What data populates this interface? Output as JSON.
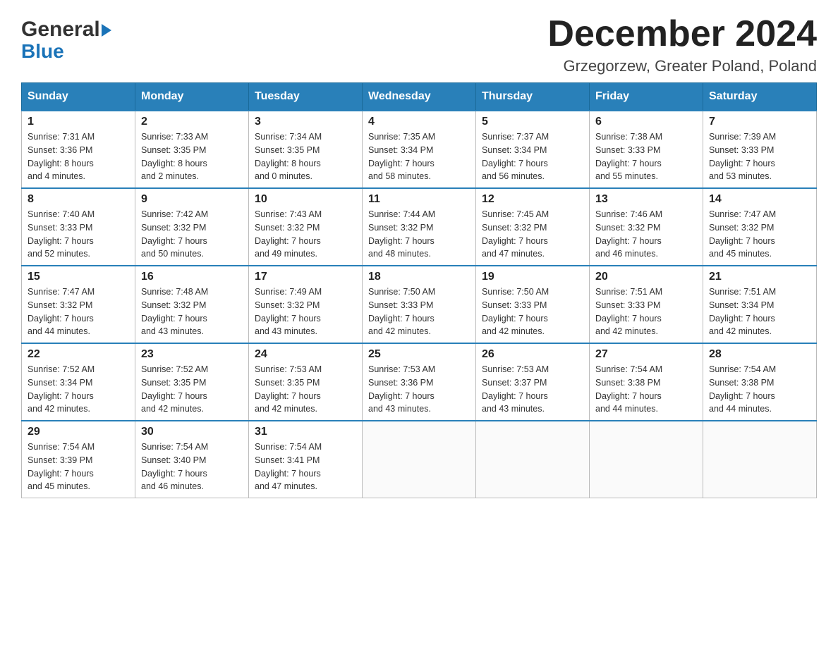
{
  "logo": {
    "general": "General",
    "blue": "Blue"
  },
  "header": {
    "month": "December 2024",
    "location": "Grzegorzew, Greater Poland, Poland"
  },
  "weekdays": [
    "Sunday",
    "Monday",
    "Tuesday",
    "Wednesday",
    "Thursday",
    "Friday",
    "Saturday"
  ],
  "weeks": [
    [
      {
        "day": "1",
        "sunrise": "7:31 AM",
        "sunset": "3:36 PM",
        "daylight": "8 hours and 4 minutes."
      },
      {
        "day": "2",
        "sunrise": "7:33 AM",
        "sunset": "3:35 PM",
        "daylight": "8 hours and 2 minutes."
      },
      {
        "day": "3",
        "sunrise": "7:34 AM",
        "sunset": "3:35 PM",
        "daylight": "8 hours and 0 minutes."
      },
      {
        "day": "4",
        "sunrise": "7:35 AM",
        "sunset": "3:34 PM",
        "daylight": "7 hours and 58 minutes."
      },
      {
        "day": "5",
        "sunrise": "7:37 AM",
        "sunset": "3:34 PM",
        "daylight": "7 hours and 56 minutes."
      },
      {
        "day": "6",
        "sunrise": "7:38 AM",
        "sunset": "3:33 PM",
        "daylight": "7 hours and 55 minutes."
      },
      {
        "day": "7",
        "sunrise": "7:39 AM",
        "sunset": "3:33 PM",
        "daylight": "7 hours and 53 minutes."
      }
    ],
    [
      {
        "day": "8",
        "sunrise": "7:40 AM",
        "sunset": "3:33 PM",
        "daylight": "7 hours and 52 minutes."
      },
      {
        "day": "9",
        "sunrise": "7:42 AM",
        "sunset": "3:32 PM",
        "daylight": "7 hours and 50 minutes."
      },
      {
        "day": "10",
        "sunrise": "7:43 AM",
        "sunset": "3:32 PM",
        "daylight": "7 hours and 49 minutes."
      },
      {
        "day": "11",
        "sunrise": "7:44 AM",
        "sunset": "3:32 PM",
        "daylight": "7 hours and 48 minutes."
      },
      {
        "day": "12",
        "sunrise": "7:45 AM",
        "sunset": "3:32 PM",
        "daylight": "7 hours and 47 minutes."
      },
      {
        "day": "13",
        "sunrise": "7:46 AM",
        "sunset": "3:32 PM",
        "daylight": "7 hours and 46 minutes."
      },
      {
        "day": "14",
        "sunrise": "7:47 AM",
        "sunset": "3:32 PM",
        "daylight": "7 hours and 45 minutes."
      }
    ],
    [
      {
        "day": "15",
        "sunrise": "7:47 AM",
        "sunset": "3:32 PM",
        "daylight": "7 hours and 44 minutes."
      },
      {
        "day": "16",
        "sunrise": "7:48 AM",
        "sunset": "3:32 PM",
        "daylight": "7 hours and 43 minutes."
      },
      {
        "day": "17",
        "sunrise": "7:49 AM",
        "sunset": "3:32 PM",
        "daylight": "7 hours and 43 minutes."
      },
      {
        "day": "18",
        "sunrise": "7:50 AM",
        "sunset": "3:33 PM",
        "daylight": "7 hours and 42 minutes."
      },
      {
        "day": "19",
        "sunrise": "7:50 AM",
        "sunset": "3:33 PM",
        "daylight": "7 hours and 42 minutes."
      },
      {
        "day": "20",
        "sunrise": "7:51 AM",
        "sunset": "3:33 PM",
        "daylight": "7 hours and 42 minutes."
      },
      {
        "day": "21",
        "sunrise": "7:51 AM",
        "sunset": "3:34 PM",
        "daylight": "7 hours and 42 minutes."
      }
    ],
    [
      {
        "day": "22",
        "sunrise": "7:52 AM",
        "sunset": "3:34 PM",
        "daylight": "7 hours and 42 minutes."
      },
      {
        "day": "23",
        "sunrise": "7:52 AM",
        "sunset": "3:35 PM",
        "daylight": "7 hours and 42 minutes."
      },
      {
        "day": "24",
        "sunrise": "7:53 AM",
        "sunset": "3:35 PM",
        "daylight": "7 hours and 42 minutes."
      },
      {
        "day": "25",
        "sunrise": "7:53 AM",
        "sunset": "3:36 PM",
        "daylight": "7 hours and 43 minutes."
      },
      {
        "day": "26",
        "sunrise": "7:53 AM",
        "sunset": "3:37 PM",
        "daylight": "7 hours and 43 minutes."
      },
      {
        "day": "27",
        "sunrise": "7:54 AM",
        "sunset": "3:38 PM",
        "daylight": "7 hours and 44 minutes."
      },
      {
        "day": "28",
        "sunrise": "7:54 AM",
        "sunset": "3:38 PM",
        "daylight": "7 hours and 44 minutes."
      }
    ],
    [
      {
        "day": "29",
        "sunrise": "7:54 AM",
        "sunset": "3:39 PM",
        "daylight": "7 hours and 45 minutes."
      },
      {
        "day": "30",
        "sunrise": "7:54 AM",
        "sunset": "3:40 PM",
        "daylight": "7 hours and 46 minutes."
      },
      {
        "day": "31",
        "sunrise": "7:54 AM",
        "sunset": "3:41 PM",
        "daylight": "7 hours and 47 minutes."
      },
      null,
      null,
      null,
      null
    ]
  ],
  "labels": {
    "sunrise": "Sunrise:",
    "sunset": "Sunset:",
    "daylight": "Daylight:"
  }
}
